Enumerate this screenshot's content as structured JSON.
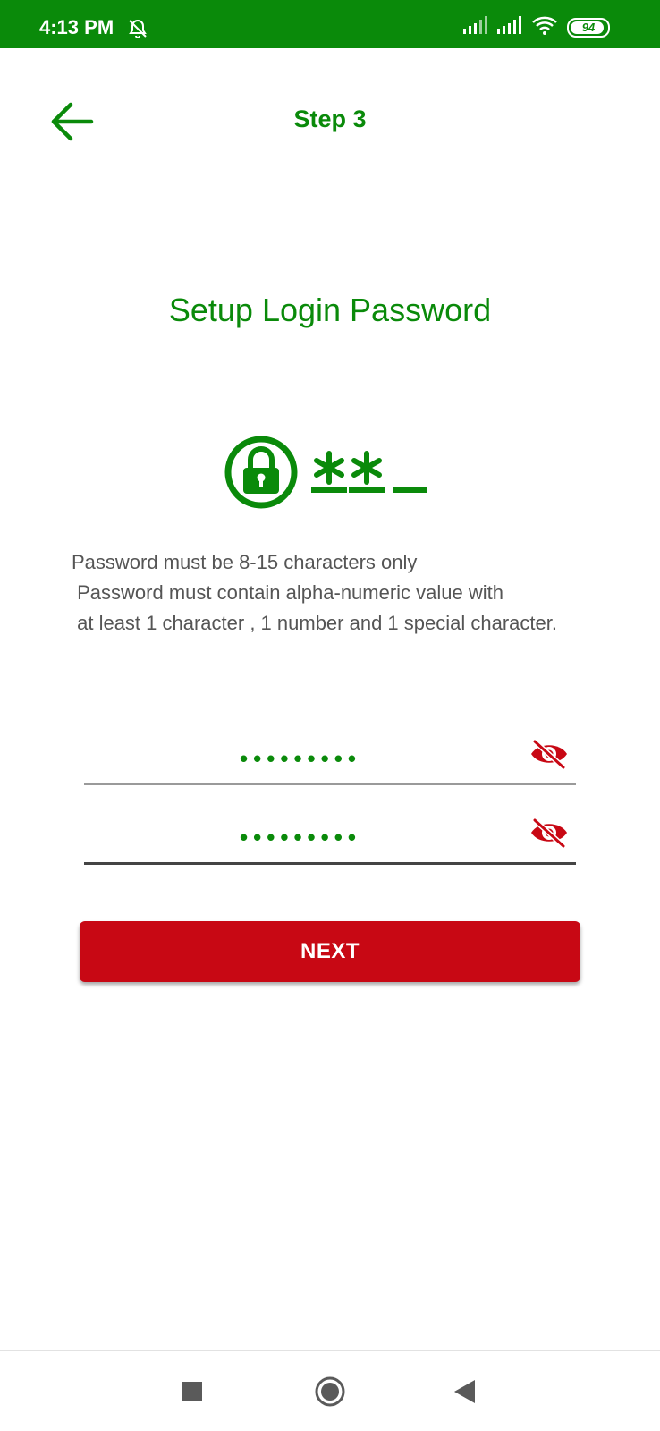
{
  "status_bar": {
    "time": "4:13 PM",
    "battery_level": "94",
    "icons": [
      "alarm-off-icon",
      "signal-icon",
      "signal-icon",
      "wifi-icon",
      "battery-icon"
    ]
  },
  "header": {
    "step_title": "Step 3",
    "back_icon": "arrow-left-icon"
  },
  "main": {
    "title": "Setup Login Password",
    "rules": [
      "Password must be 8-15 characters only",
      " Password must contain alpha-numeric value with",
      " at least 1 character , 1 number and 1 special character."
    ],
    "password_field": {
      "value": "•••••••••",
      "toggle_icon": "eye-off-icon"
    },
    "confirm_field": {
      "value": "•••••••••",
      "toggle_icon": "eye-off-icon"
    },
    "next_label": "NEXT"
  },
  "colors": {
    "brand_green": "#0a8a0a",
    "accent_red": "#c80814",
    "text_gray": "#555555"
  },
  "nav_bar": {
    "icons": [
      "recent-apps-icon",
      "home-icon",
      "back-triangle-icon"
    ]
  }
}
